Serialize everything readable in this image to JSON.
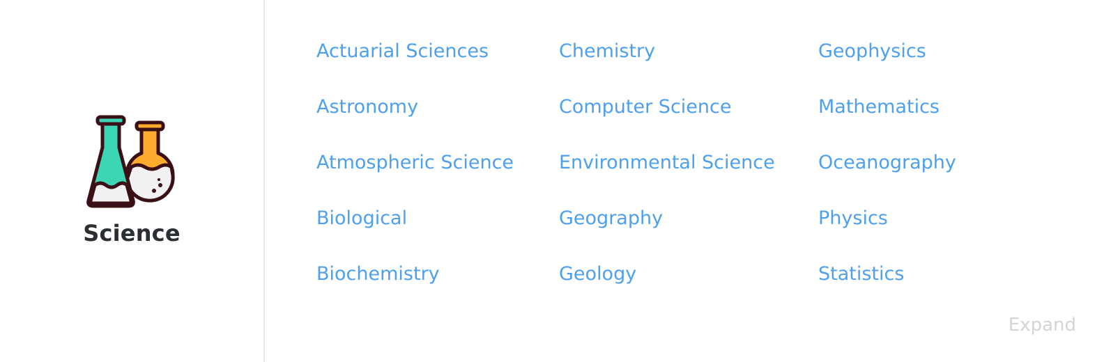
{
  "category": {
    "title": "Science",
    "icon": "lab-flasks-icon",
    "colors": {
      "conical_flask": "#3dd6b5",
      "round_flask": "#ffab2e",
      "outline": "#3a1016",
      "liquid": "#f1f1f3"
    }
  },
  "links": {
    "col1": [
      "Actuarial Sciences",
      "Astronomy",
      "Atmospheric Science",
      "Biological",
      "Biochemistry"
    ],
    "col2": [
      "Chemistry",
      "Computer Science",
      "Environmental Science",
      "Geography",
      "Geology"
    ],
    "col3": [
      "Geophysics",
      "Mathematics",
      "Oceanography",
      "Physics",
      "Statistics"
    ]
  },
  "expand_label": "Expand",
  "colors": {
    "link": "#4ea0ec",
    "title": "#2b2f33",
    "divider": "#e9e9e9",
    "expand": "#d4d4d4"
  }
}
